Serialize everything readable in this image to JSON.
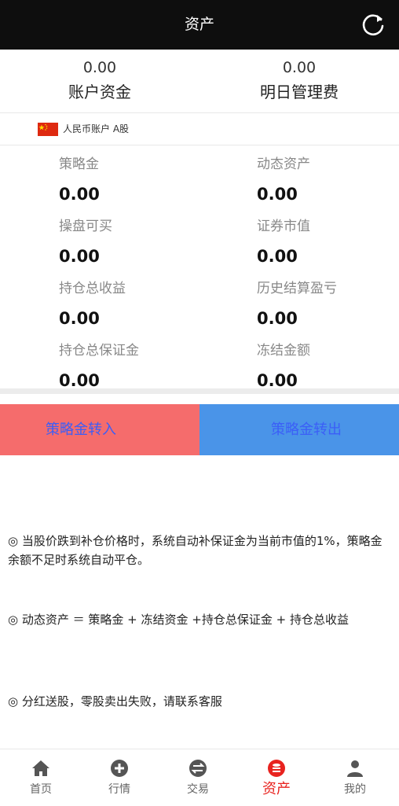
{
  "header": {
    "title": "资产",
    "refresh_icon": "refresh-icon"
  },
  "summary": {
    "account_funds": {
      "value": "0.00",
      "label": "账户资金"
    },
    "tomorrow_fee": {
      "value": "0.00",
      "label": "明日管理费"
    }
  },
  "account": {
    "label": "人民币账户 A股",
    "flag_icon": "china-flag-icon"
  },
  "stats": [
    {
      "label": "策略金",
      "value": "0.00"
    },
    {
      "label": "动态资产",
      "value": "0.00"
    },
    {
      "label": "操盘可买",
      "value": "0.00"
    },
    {
      "label": "证券市值",
      "value": "0.00"
    },
    {
      "label": "持仓总收益",
      "value": "0.00"
    },
    {
      "label": "历史结算盈亏",
      "value": "0.00"
    },
    {
      "label": "持仓总保证金",
      "value": "0.00"
    },
    {
      "label": "冻结金额",
      "value": "0.00"
    }
  ],
  "actions": {
    "transfer_in": "策略金转入",
    "transfer_out": "策略金转出"
  },
  "notes": [
    "◎ 当股价跌到补仓价格时，系统自动补保证金为当前市值的1%，策略金余额不足时系统自动平仓。",
    "◎ 动态资产 ＝ 策略金 + 冻结资金 +持仓总保证金 + 持仓总收益",
    "◎ 分红送股，零股卖出失败，请联系客服"
  ],
  "tabbar": [
    {
      "label": "首页",
      "icon": "home-icon"
    },
    {
      "label": "行情",
      "icon": "plus-circle-icon"
    },
    {
      "label": "交易",
      "icon": "exchange-icon"
    },
    {
      "label": "资产",
      "icon": "database-icon",
      "active": true
    },
    {
      "label": "我的",
      "icon": "user-icon"
    }
  ],
  "colors": {
    "topbar": "#0e0e0e",
    "transfer_in_bg": "#f56c6c",
    "transfer_out_bg": "#4a94e8",
    "button_text": "#3b5ef7",
    "active_tab": "#e8231f",
    "inactive_tab": "#555555"
  }
}
